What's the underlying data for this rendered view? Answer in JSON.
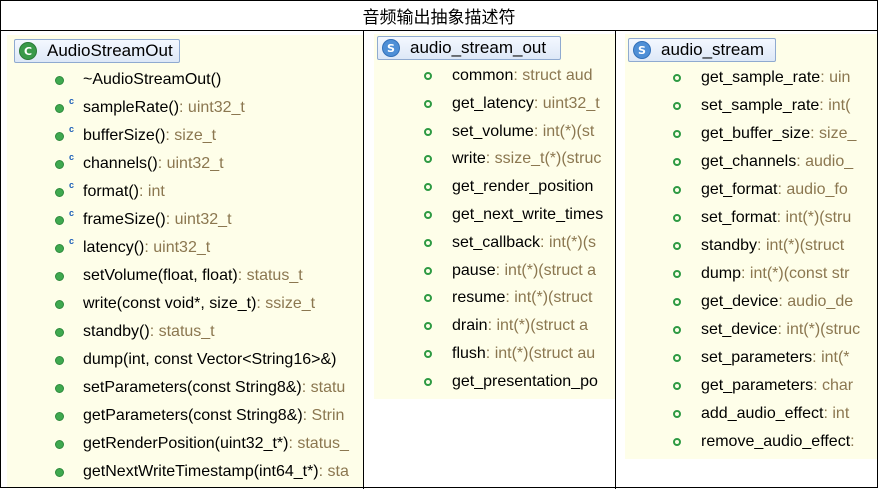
{
  "title": "音频输出抽象描述符",
  "panels": {
    "left": {
      "name": "AudioStreamOut",
      "icon": "class-icon",
      "members": [
        {
          "name": "~AudioStreamOut()",
          "type": "",
          "ctor": false
        },
        {
          "name": "sampleRate()",
          "type": " : uint32_t",
          "ctor": true
        },
        {
          "name": "bufferSize()",
          "type": " : size_t",
          "ctor": true
        },
        {
          "name": "channels()",
          "type": " : uint32_t",
          "ctor": true
        },
        {
          "name": "format()",
          "type": " : int",
          "ctor": true
        },
        {
          "name": "frameSize()",
          "type": " : uint32_t",
          "ctor": true
        },
        {
          "name": "latency()",
          "type": " : uint32_t",
          "ctor": true
        },
        {
          "name": "setVolume(float, float)",
          "type": " : status_t",
          "ctor": false
        },
        {
          "name": "write(const void*, size_t)",
          "type": " : ssize_t",
          "ctor": false
        },
        {
          "name": "standby()",
          "type": " : status_t",
          "ctor": false
        },
        {
          "name": "dump(int, const Vector<String16>&)",
          "type": "",
          "ctor": false
        },
        {
          "name": "setParameters(const String8&)",
          "type": " : statu",
          "ctor": false
        },
        {
          "name": "getParameters(const String8&)",
          "type": " : Strin",
          "ctor": false
        },
        {
          "name": "getRenderPosition(uint32_t*)",
          "type": " : status_",
          "ctor": false
        },
        {
          "name": "getNextWriteTimestamp(int64_t*)",
          "type": " : sta",
          "ctor": false
        }
      ]
    },
    "middle": {
      "name": "audio_stream_out",
      "icon": "struct-icon",
      "members": [
        {
          "name": "common",
          "type": " : struct aud"
        },
        {
          "name": "get_latency",
          "type": " : uint32_t"
        },
        {
          "name": "set_volume",
          "type": " : int(*)(st"
        },
        {
          "name": "write",
          "type": " : ssize_t(*)(struc"
        },
        {
          "name": "get_render_position",
          "type": ""
        },
        {
          "name": "get_next_write_times",
          "type": ""
        },
        {
          "name": "set_callback",
          "type": " : int(*)(s"
        },
        {
          "name": "pause",
          "type": " : int(*)(struct a"
        },
        {
          "name": "resume",
          "type": " : int(*)(struct"
        },
        {
          "name": "drain",
          "type": " : int(*)(struct a"
        },
        {
          "name": "flush",
          "type": " : int(*)(struct au"
        },
        {
          "name": "get_presentation_po",
          "type": ""
        }
      ]
    },
    "right": {
      "name": "audio_stream",
      "icon": "struct-icon",
      "members": [
        {
          "name": "get_sample_rate",
          "type": " : uin"
        },
        {
          "name": "set_sample_rate",
          "type": " : int("
        },
        {
          "name": "get_buffer_size",
          "type": " : size_"
        },
        {
          "name": "get_channels",
          "type": " : audio_"
        },
        {
          "name": "get_format",
          "type": " : audio_fo"
        },
        {
          "name": "set_format",
          "type": " : int(*)(stru"
        },
        {
          "name": "standby",
          "type": " : int(*)(struct"
        },
        {
          "name": "dump",
          "type": " : int(*)(const str"
        },
        {
          "name": "get_device",
          "type": " : audio_de"
        },
        {
          "name": "set_device",
          "type": " : int(*)(struc"
        },
        {
          "name": "set_parameters",
          "type": " : int(*"
        },
        {
          "name": "get_parameters",
          "type": " : char"
        },
        {
          "name": "add_audio_effect",
          "type": " : int"
        },
        {
          "name": "remove_audio_effect",
          "type": " :"
        }
      ]
    }
  }
}
